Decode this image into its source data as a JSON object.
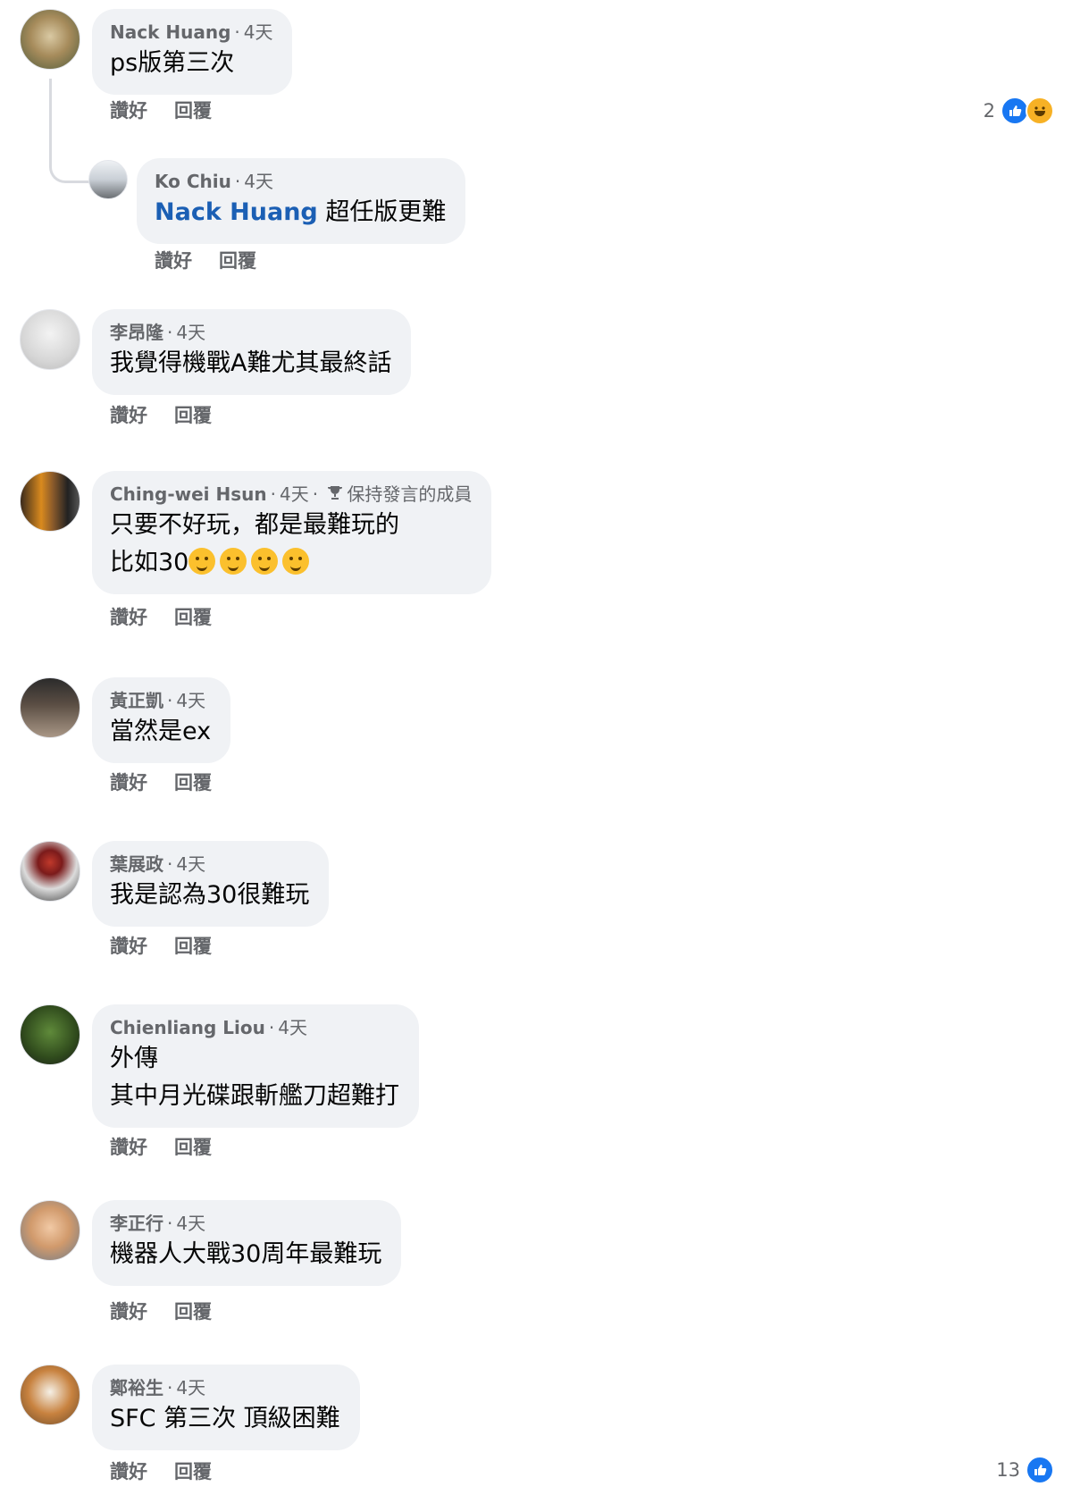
{
  "actions": {
    "like": "讚好",
    "reply": "回覆"
  },
  "comments": [
    {
      "name": "Nack Huang",
      "time": "4天",
      "text": "ps版第三次",
      "reactions_count": "2"
    },
    {
      "name": "Ko Chiu",
      "time": "4天",
      "mention": "Nack Huang",
      "text": "超任版更難"
    },
    {
      "name": "李昂隆",
      "time": "4天",
      "text": "我覺得機戰A難尤其最終話"
    },
    {
      "name": "Ching-wei Hsun",
      "time": "4天",
      "badge": "保持發言的成員",
      "text_line1": "只要不好玩，都是最難玩的",
      "text_line2": "比如30"
    },
    {
      "name": "黃正凱",
      "time": "4天",
      "text": "當然是ex"
    },
    {
      "name": "葉展政",
      "time": "4天",
      "text": "我是認為30很難玩"
    },
    {
      "name": "Chienliang Liou",
      "time": "4天",
      "text_line1": "外傳",
      "text_line2": "其中月光碟跟斬艦刀超難打"
    },
    {
      "name": "李正行",
      "time": "4天",
      "text": "機器人大戰30周年最難玩"
    },
    {
      "name": "鄭裕生",
      "time": "4天",
      "text": "SFC 第三次 頂級困難",
      "reactions_count": "13"
    }
  ],
  "colors": {
    "link": "#1b5fb4",
    "like_reaction": "#1877f2",
    "bubble": "#f0f2f5"
  },
  "icons": [
    "like-reaction-icon",
    "haha-reaction-icon",
    "trophy-icon",
    "hugging-face-emoji"
  ]
}
